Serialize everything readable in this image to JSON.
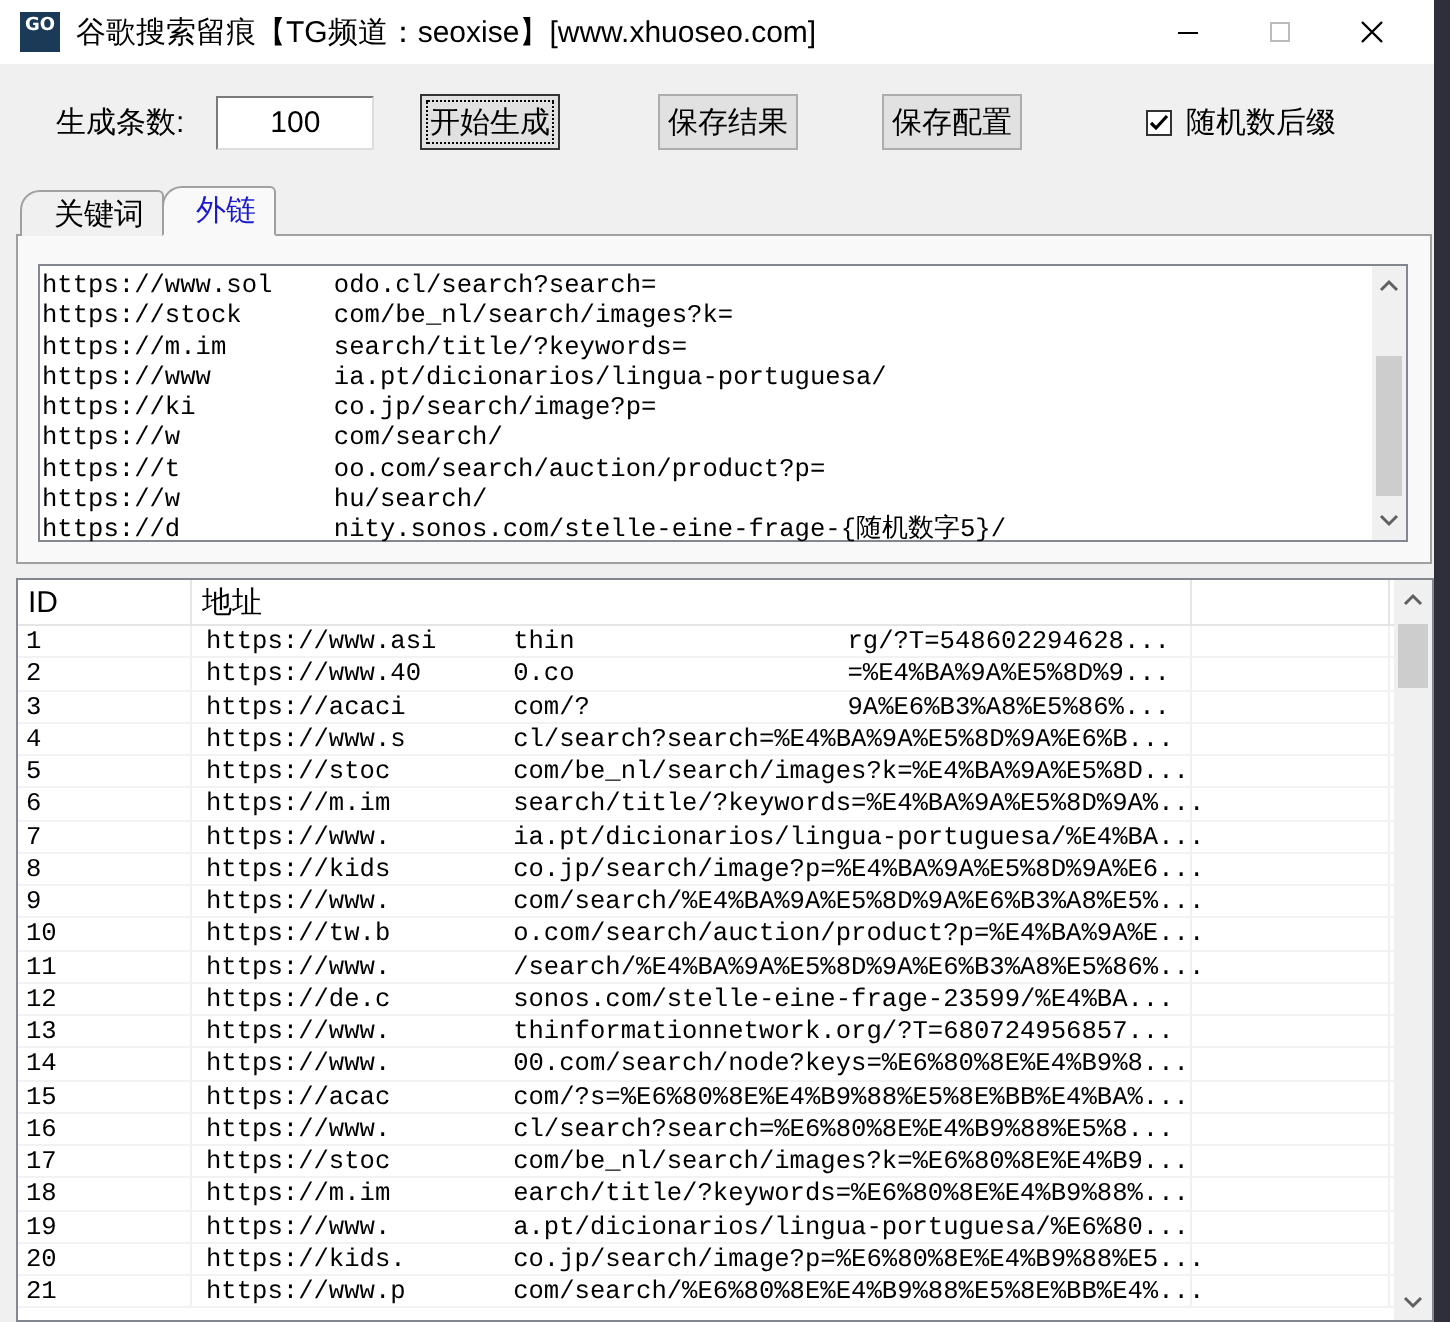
{
  "window": {
    "icon_text": "GO",
    "title": "谷歌搜索留痕【TG频道：seoxise】[www.xhuoseo.com]"
  },
  "toolbar": {
    "count_label": "生成条数:",
    "count_value": "100",
    "buttons": [
      {
        "label": "开始生成",
        "focused": true
      },
      {
        "label": "保存结果",
        "focused": false
      },
      {
        "label": "保存配置",
        "focused": false
      }
    ],
    "random_suffix": {
      "label": "随机数后缀",
      "checked": true
    }
  },
  "tabs": [
    {
      "label": "关键词",
      "selected": false
    },
    {
      "label": "外链",
      "selected": true
    }
  ],
  "editor": {
    "lines": [
      {
        "parts": [
          "https://www.sol",
          "odo.cl/search?search="
        ]
      },
      {
        "parts": [
          "https://stock",
          "com/be_nl/search/images?k="
        ]
      },
      {
        "parts": [
          "https://m.im",
          "search/title/?keywords="
        ]
      },
      {
        "parts": [
          "https://www",
          "ia.pt/dicionarios/lingua-portuguesa/"
        ]
      },
      {
        "parts": [
          "https://ki",
          "co.jp/search/image?p="
        ]
      },
      {
        "parts": [
          "https://w",
          "com/search/"
        ]
      },
      {
        "parts": [
          "https://t",
          "oo.com/search/auction/product?p="
        ]
      },
      {
        "parts": [
          "https://w",
          "hu/search/"
        ]
      },
      {
        "parts": [
          "https://d",
          "nity.sonos.com/stelle-eine-frage-{随机数字5}/"
        ]
      }
    ]
  },
  "results": {
    "columns": [
      "ID",
      "地址"
    ],
    "rows": [
      {
        "id": "1",
        "parts": [
          "https://www.asi",
          "thin",
          "rg/?T=548602294628..."
        ]
      },
      {
        "id": "2",
        "parts": [
          "https://www.40",
          "0.co",
          "=%E4%BA%9A%E5%8D%9..."
        ]
      },
      {
        "id": "3",
        "parts": [
          "https://acaci",
          "com/?",
          "9A%E6%B3%A8%E5%86%..."
        ]
      },
      {
        "id": "4",
        "parts": [
          "https://www.s",
          "cl/search?search=%E4%BA%9A%E5%8D%9A%E6%B..."
        ]
      },
      {
        "id": "5",
        "parts": [
          "https://stoc",
          "com/be_nl/search/images?k=%E4%BA%9A%E5%8D..."
        ]
      },
      {
        "id": "6",
        "parts": [
          "https://m.im",
          "search/title/?keywords=%E4%BA%9A%E5%8D%9A%..."
        ]
      },
      {
        "id": "7",
        "parts": [
          "https://www.",
          "ia.pt/dicionarios/lingua-portuguesa/%E4%BA..."
        ]
      },
      {
        "id": "8",
        "parts": [
          "https://kids",
          "co.jp/search/image?p=%E4%BA%9A%E5%8D%9A%E6..."
        ]
      },
      {
        "id": "9",
        "parts": [
          "https://www.",
          "com/search/%E4%BA%9A%E5%8D%9A%E6%B3%A8%E5%..."
        ]
      },
      {
        "id": "10",
        "parts": [
          "https://tw.b",
          "o.com/search/auction/product?p=%E4%BA%9A%E..."
        ]
      },
      {
        "id": "11",
        "parts": [
          "https://www.",
          "/search/%E4%BA%9A%E5%8D%9A%E6%B3%A8%E5%86%..."
        ]
      },
      {
        "id": "12",
        "parts": [
          "https://de.c",
          "sonos.com/stelle-eine-frage-23599/%E4%BA..."
        ]
      },
      {
        "id": "13",
        "parts": [
          "https://www.",
          "thinformationnetwork.org/?T=680724956857..."
        ]
      },
      {
        "id": "14",
        "parts": [
          "https://www.",
          "00.com/search/node?keys=%E6%80%8E%E4%B9%8..."
        ]
      },
      {
        "id": "15",
        "parts": [
          "https://acac",
          "com/?s=%E6%80%8E%E4%B9%88%E5%8E%BB%E4%BA%..."
        ]
      },
      {
        "id": "16",
        "parts": [
          "https://www.",
          "cl/search?search=%E6%80%8E%E4%B9%88%E5%8..."
        ]
      },
      {
        "id": "17",
        "parts": [
          "https://stoc",
          "com/be_nl/search/images?k=%E6%80%8E%E4%B9..."
        ]
      },
      {
        "id": "18",
        "parts": [
          "https://m.im",
          "earch/title/?keywords=%E6%80%8E%E4%B9%88%..."
        ]
      },
      {
        "id": "19",
        "parts": [
          "https://www.",
          "a.pt/dicionarios/lingua-portuguesa/%E6%80..."
        ]
      },
      {
        "id": "20",
        "parts": [
          "https://kids.",
          "co.jp/search/image?p=%E6%80%8E%E4%B9%88%E5..."
        ]
      },
      {
        "id": "21",
        "parts": [
          "https://www.p",
          "com/search/%E6%80%8E%E4%B9%88%E5%8E%BB%E4%..."
        ]
      }
    ]
  }
}
